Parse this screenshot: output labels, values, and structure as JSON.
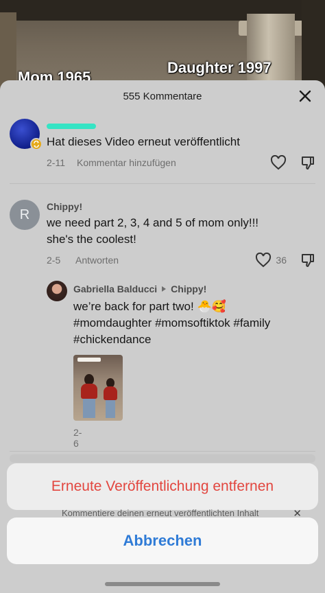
{
  "video": {
    "overlay_left": "Mom 1965",
    "overlay_right": "Daughter 1997"
  },
  "sheet": {
    "title": "555 Kommentare"
  },
  "comments": [
    {
      "name": "",
      "text": "Hat dieses Video erneut veröffentlicht",
      "date": "2-11",
      "action": "Kommentar hinzufügen",
      "likes": ""
    },
    {
      "avatar_letter": "R",
      "name": "Chippy!",
      "text_line1": "we need part 2, 3, 4 and 5 of mom only!!!",
      "text_line2": "she's the coolest!",
      "date": "2-5",
      "action": "Antworten",
      "likes": "36"
    }
  ],
  "reply": {
    "author": "Gabriella Balducci",
    "reply_to": "Chippy!",
    "text_line1": "we’re back for part two! 🐣🥰",
    "text_line2": "#momdaughter #momsoftiktok #family",
    "text_line3": "#chickendance",
    "date": "2-6"
  },
  "action_sheet": {
    "remove_label": "Erneute Veröffentlichung entfernen",
    "cancel_label": "Abbrechen",
    "repost_note": "Kommentiere deinen erneut veröffentlichten Inhalt"
  },
  "colors": {
    "destructive": "#e2463f",
    "cancel": "#2f7bd6",
    "repost_badge": "#e5a918"
  }
}
